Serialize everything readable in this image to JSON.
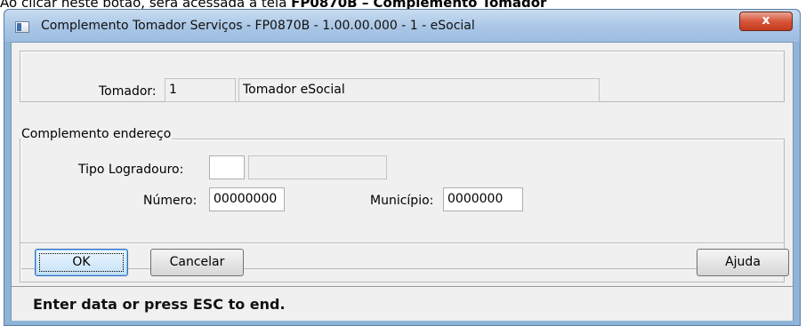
{
  "document": {
    "intro_text": "Ao clicar neste botão, será acessada a tela",
    "intro_bold": "FP0870B – Complemento Tomador"
  },
  "window": {
    "title": "Complemento Tomador Serviços - FP0870B - 1.00.00.000 - 1 - eSocial",
    "close_glyph": "x"
  },
  "tomador": {
    "label": "Tomador:",
    "code": "1",
    "name": "Tomador eSocial"
  },
  "complemento": {
    "legend": "Complemento endereço",
    "tipo_logradouro_label": "Tipo Logradouro:",
    "tipo_logradouro_code": "",
    "tipo_logradouro_desc": "",
    "numero_label": "Número:",
    "numero_value": "00000000",
    "municipio_label": "Município:",
    "municipio_value": "0000000"
  },
  "buttons": {
    "ok": "OK",
    "cancel": "Cancelar",
    "help": "Ajuda"
  },
  "status": {
    "message": "Enter data or press ESC to end."
  }
}
